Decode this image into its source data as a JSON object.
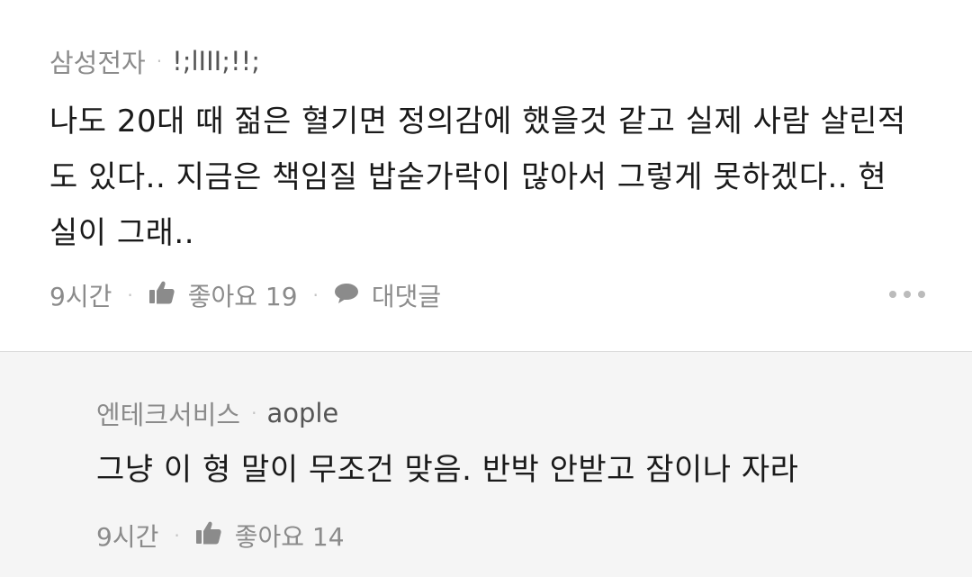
{
  "comments": [
    {
      "author": "삼성전자",
      "nickname": "!;lIII;!!;",
      "text": "나도 20대 때 젊은 혈기면 정의감에 했을것 같고 실제 사람 살린적도 있다.. 지금은 책임질 밥숟가락이 많아서 그렇게 못하겠다.. 현실이 그래..",
      "time": "9시간",
      "like_label": "좋아요 19",
      "reply_label": "대댓글"
    }
  ],
  "reply": {
    "author": "엔테크서비스",
    "nickname": "aople",
    "text": "그냥 이 형 말이 무조건 맞음. 반박 안받고 잠이나 자라",
    "time": "9시간",
    "like_label": "좋아요 14"
  },
  "separator": "·",
  "colors": {
    "reply_background": "#f5f5f5",
    "meta_text": "#8b8b8b",
    "body_text": "#1a1a1a"
  },
  "icons": {
    "like": "thumbs-up-icon",
    "reply": "speech-bubble-icon",
    "more": "more-dots-icon"
  }
}
